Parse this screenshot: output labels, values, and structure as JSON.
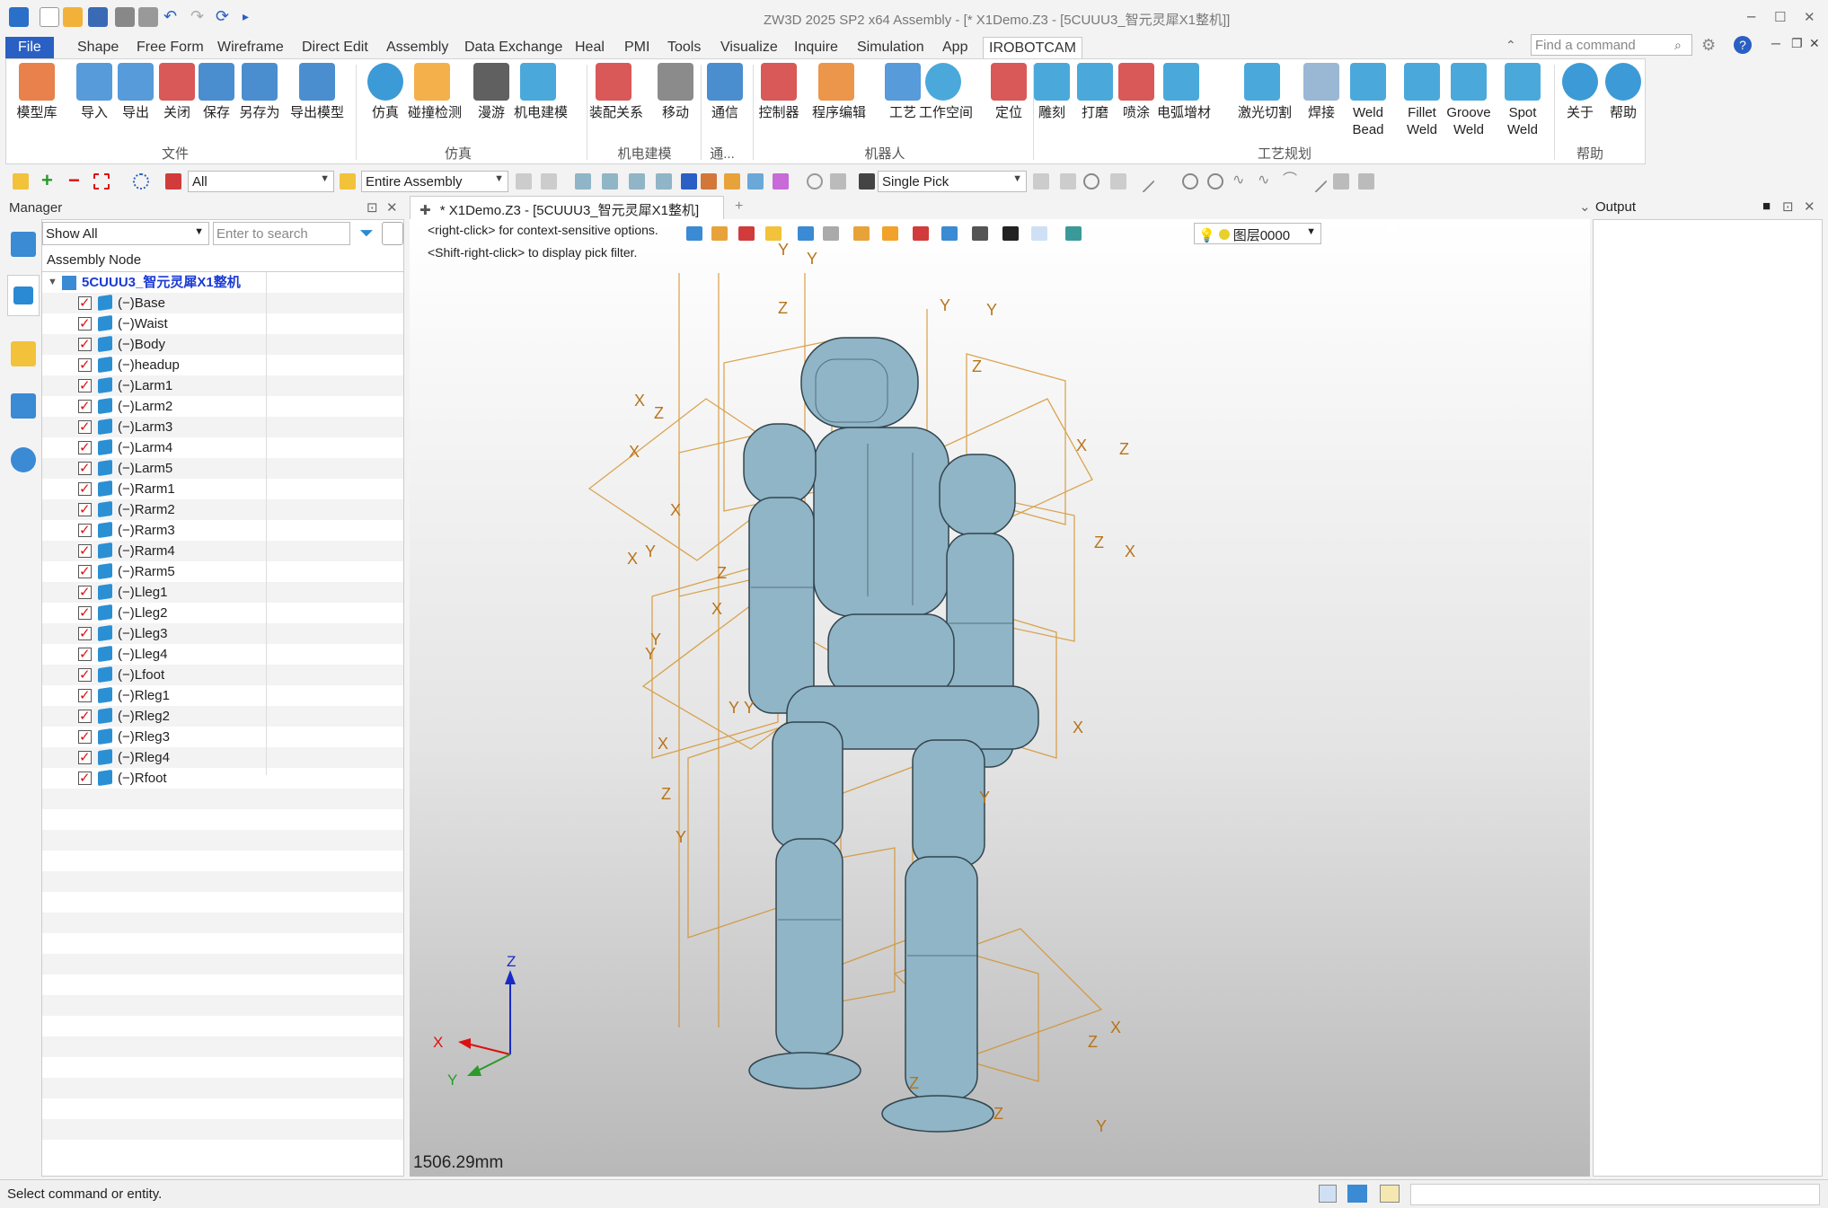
{
  "title_bar": {
    "title": "ZW3D 2025 SP2 x64       Assembly - [* X1Demo.Z3 - [5CUUU3_智元灵犀X1整机]]"
  },
  "menu": {
    "items": [
      "File",
      "Shape",
      "Free Form",
      "Wireframe",
      "Direct Edit",
      "Assembly",
      "Data Exchange",
      "Heal",
      "PMI",
      "Tools",
      "Visualize",
      "Inquire",
      "Simulation",
      "App",
      "IROBOTCAM"
    ],
    "active": "IROBOTCAM",
    "search_placeholder": "Find a command"
  },
  "ribbon": {
    "buttons": [
      {
        "label": "模型库",
        "color": "#e46b2c"
      },
      {
        "label": "导入",
        "color": "#3a8ad4"
      },
      {
        "label": "导出",
        "color": "#3a8ad4"
      },
      {
        "label": "关闭",
        "color": "#d23b3b"
      },
      {
        "label": "保存",
        "color": "#2a7ac8"
      },
      {
        "label": "另存为",
        "color": "#2a7ac8"
      },
      {
        "label": "导出模型",
        "color": "#2a7ac8"
      },
      {
        "label": "仿真",
        "color": "#1a88d0"
      },
      {
        "label": "碰撞检测",
        "color": "#f2a22a"
      },
      {
        "label": "漫游",
        "color": "#444444"
      },
      {
        "label": "机电建模",
        "color": "#2a9ad4"
      },
      {
        "label": "装配关系",
        "color": "#d23b3b"
      },
      {
        "label": "移动",
        "color": "#777777"
      },
      {
        "label": "通信",
        "color": "#2a7ac8"
      },
      {
        "label": "控制器",
        "color": "#d23b3b"
      },
      {
        "label": "程序编辑",
        "color": "#e8842a"
      },
      {
        "label": "工艺",
        "color": "#3a8ad4"
      },
      {
        "label": "工作空间",
        "color": "#2a9ad4"
      },
      {
        "label": "定位",
        "color": "#d23b3b"
      },
      {
        "label": "雕刻",
        "color": "#2a9ad4"
      },
      {
        "label": "打磨",
        "color": "#2a9ad4"
      },
      {
        "label": "喷涂",
        "color": "#d23b3b"
      },
      {
        "label": "电弧增材",
        "color": "#2a9ad4"
      },
      {
        "label": "激光切割",
        "color": "#2a9ad4"
      },
      {
        "label": "焊接",
        "color": "#88aacc"
      },
      {
        "label": "Weld\nBead",
        "color": "#2a9ad4"
      },
      {
        "label": "Fillet\nWeld",
        "color": "#2a9ad4"
      },
      {
        "label": "Groove\nWeld",
        "color": "#2a9ad4"
      },
      {
        "label": "Spot\nWeld",
        "color": "#2a9ad4"
      },
      {
        "label": "关于",
        "color": "#1a88d0"
      },
      {
        "label": "帮助",
        "color": "#1a88d0"
      }
    ],
    "groups": [
      "文件",
      "仿真",
      "机电建模",
      "通...",
      "机器人",
      "工艺规划",
      "帮助"
    ]
  },
  "toolbar": {
    "filter_value": "All",
    "scope_value": "Entire Assembly",
    "pick_value": "Single Pick"
  },
  "manager": {
    "title": "Manager",
    "show_value": "Show All",
    "search_placeholder": "Enter to search",
    "column_header": "Assembly Node",
    "root": "5CUUU3_智元灵犀X1整机",
    "nodes": [
      "(−)Base",
      "(−)Waist",
      "(−)Body",
      "(−)headup",
      "(−)Larm1",
      "(−)Larm2",
      "(−)Larm3",
      "(−)Larm4",
      "(−)Larm5",
      "(−)Rarm1",
      "(−)Rarm2",
      "(−)Rarm3",
      "(−)Rarm4",
      "(−)Rarm5",
      "(−)Lleg1",
      "(−)Lleg2",
      "(−)Lleg3",
      "(−)Lleg4",
      "(−)Lfoot",
      "(−)Rleg1",
      "(−)Rleg2",
      "(−)Rleg3",
      "(−)Rleg4",
      "(−)Rfoot"
    ]
  },
  "viewport": {
    "tab_title": "* X1Demo.Z3 - [5CUUU3_智元灵犀X1整机]",
    "hint1": "<right-click> for context-sensitive options.",
    "hint2": "<Shift-right-click> to display pick filter.",
    "layer": "图层0000",
    "scale": "1506.29mm",
    "triad": {
      "x": "X",
      "y": "Y",
      "z": "Z"
    }
  },
  "output": {
    "title": "Output"
  },
  "status": {
    "text": "Select command or entity."
  },
  "colors": {
    "accent": "#2a5fc4",
    "frame": "#d28a1c",
    "robot": "#8fb5c6"
  }
}
